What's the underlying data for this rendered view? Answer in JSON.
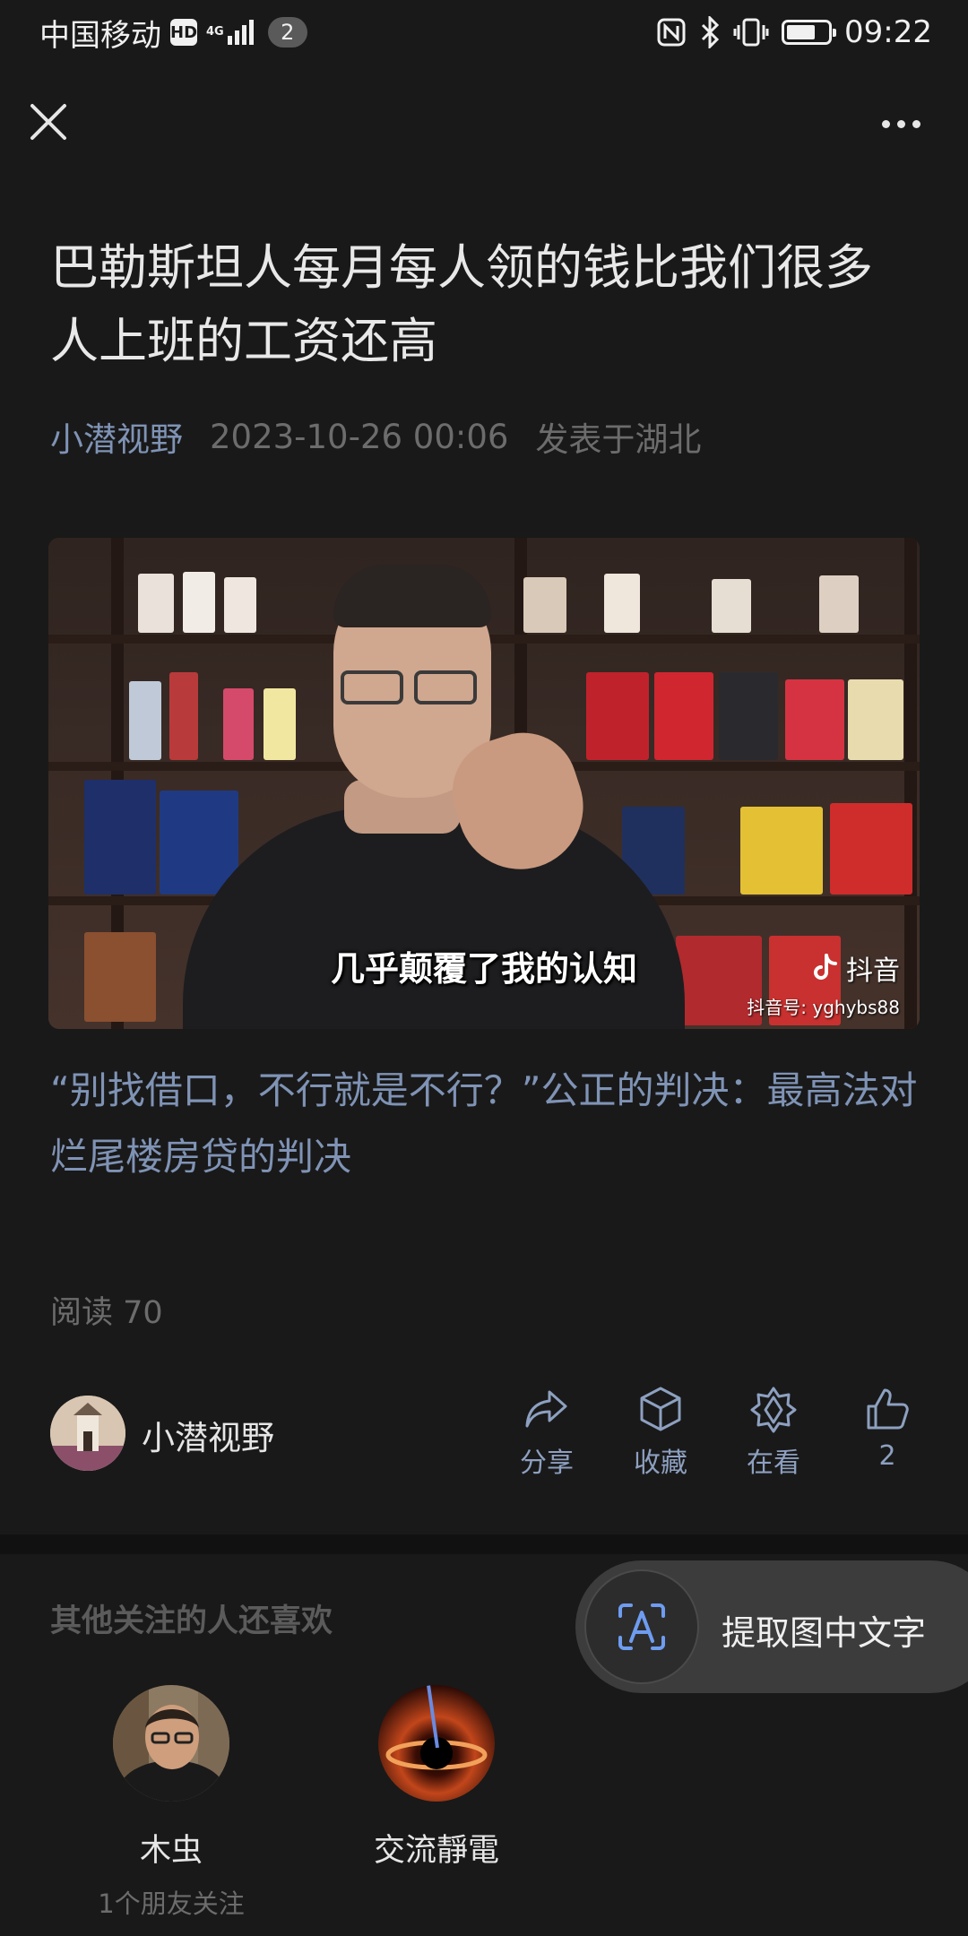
{
  "status_bar": {
    "carrier": "中国移动",
    "hd": "HD",
    "network": "4G",
    "notification_count": "2",
    "time": "09:22",
    "battery_level": 0.7
  },
  "nav": {
    "close_icon": "close-icon",
    "more_icon": "more-icon"
  },
  "article": {
    "title": "巴勒斯坦人每月每人领的钱比我们很多人上班的工资还高",
    "author": "小潜视野",
    "date": "2023-10-26 00:06",
    "location": "发表于湖北",
    "video": {
      "subtitle": "几乎颠覆了我的认知",
      "watermark": "抖音",
      "watermark_id": "抖音号: yghybs88"
    },
    "caption": "“别找借口，不行就是不行？”公正的判决：最高法对烂尾楼房贷的判决",
    "read_count": "阅读 70"
  },
  "author_bar": {
    "name": "小潜视野",
    "actions": [
      {
        "icon": "share-icon",
        "label": "分享"
      },
      {
        "icon": "cube-icon",
        "label": "收藏"
      },
      {
        "icon": "flower-icon",
        "label": "在看"
      },
      {
        "icon": "thumbs-up-icon",
        "label": "2"
      }
    ]
  },
  "recommend": {
    "title": "其他关注的人还喜欢",
    "items": [
      {
        "name": "木虫",
        "subtitle": "1个朋友关注"
      },
      {
        "name": "交流靜電",
        "subtitle": ""
      }
    ]
  },
  "ocr_button": {
    "icon": "text-scan-icon",
    "label": "提取图中文字"
  },
  "colors": {
    "background": "#191919",
    "link": "#7f93b5",
    "muted": "#6c6c6c",
    "action": "#8da0c0"
  }
}
